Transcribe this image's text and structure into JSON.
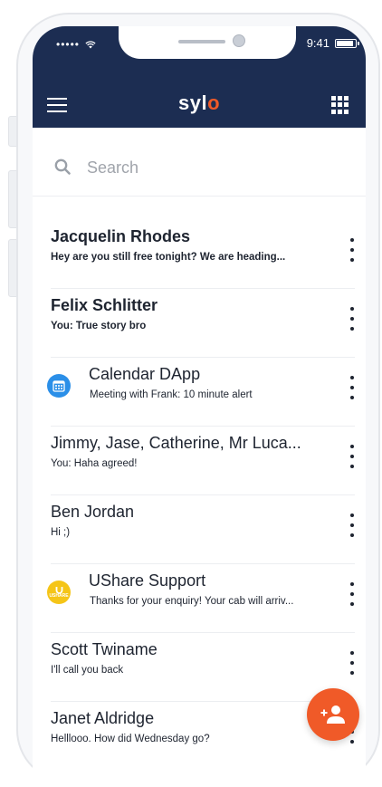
{
  "status": {
    "time": "9:41",
    "signal": "•••••"
  },
  "header": {
    "logo_main": "syl",
    "logo_accent": "o"
  },
  "search": {
    "placeholder": "Search"
  },
  "conversations": [
    {
      "title": "Jacquelin Rhodes",
      "preview": "Hey are you still free tonight? We are heading...",
      "bold": true,
      "icon": null
    },
    {
      "title": "Felix Schlitter",
      "preview": "You: True story bro",
      "bold": true,
      "icon": null
    },
    {
      "title": "Calendar DApp",
      "preview": "Meeting with Frank: 10 minute alert",
      "bold": false,
      "icon": "calendar-icon"
    },
    {
      "title": "Jimmy, Jase, Catherine, Mr Luca...",
      "preview": "You: Haha agreed!",
      "bold": false,
      "icon": null
    },
    {
      "title": "Ben Jordan",
      "preview": "Hi ;)",
      "bold": false,
      "icon": null
    },
    {
      "title": "UShare Support",
      "preview": "Thanks for your enquiry! Your cab will arriv...",
      "bold": false,
      "icon": "ushare-logo-icon",
      "icon_text": "USHARE"
    },
    {
      "title": "Scott Twiname",
      "preview": "I'll call you back",
      "bold": false,
      "icon": null
    },
    {
      "title": "Janet Aldridge",
      "preview": "Helllooo. How did Wednesday go?",
      "bold": false,
      "icon": null
    }
  ],
  "colors": {
    "header_bg": "#1c2d52",
    "accent": "#f05a28",
    "calendar_blue": "#2b8fe8",
    "ushare_yellow": "#f5c518"
  },
  "fab": {
    "icon": "add-contact-icon"
  }
}
